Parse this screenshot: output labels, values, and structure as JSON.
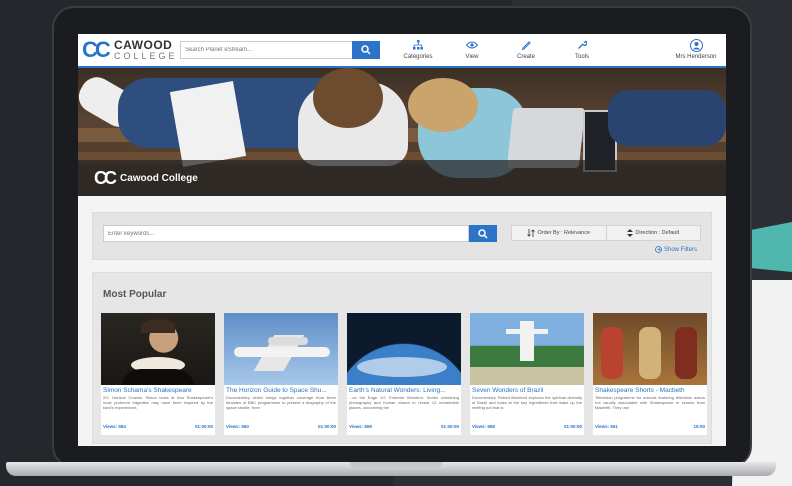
{
  "colors": {
    "brand_blue": "#2b74c7",
    "header_bg": "#ffffff",
    "page_bg": "#f4f4f4"
  },
  "header": {
    "logo_mark": "CC",
    "logo_name": "CAWOOD",
    "logo_sub": "COLLEGE",
    "search_placeholder": "Search Planet eStream...",
    "nav": [
      {
        "label": "Categories",
        "icon": "sitemap-icon"
      },
      {
        "label": "View",
        "icon": "eye-icon"
      },
      {
        "label": "Create",
        "icon": "pencil-icon"
      },
      {
        "label": "Tools",
        "icon": "wrench-icon"
      }
    ],
    "user_name": "Mrs Henderson",
    "user_icon": "user-avatar-icon"
  },
  "hero": {
    "mark": "CC",
    "title": "Cawood College"
  },
  "filter": {
    "placeholder": "Enter keywords...",
    "order_by": "Order By : Relevance",
    "direction": "Direction : Default",
    "show_filters": "Show Filters"
  },
  "popular": {
    "heading": "Most Popular",
    "items": [
      {
        "title": "Simon Schama's Shakespeare",
        "desc": "2/2. Horizon Crowns. Simon looks at how Shakespeare's most profound tragedies may have been inspired by the bard's experiences",
        "views": "Views: 584",
        "duration": "01:00:00"
      },
      {
        "title": "The Horizon Guide to Space Shu...",
        "desc": "Documentary which brings together coverage from three decades of BBC programmes to present a biography of the space shuttle, from",
        "views": "Views: 660",
        "duration": "01:00:00"
      },
      {
        "title": "Earth's Natural Wonders: Living...",
        "desc": "...on the Edge 1/2. Extreme Wonders: Series combining photography and human drama to reveal 12 remarkable places, uncovering the",
        "views": "Views: 659",
        "duration": "01:00:00"
      },
      {
        "title": "Seven Wonders of Brazil",
        "desc": "Documentary. Robert Beckford explores the spiritual diversity of Brazil and looks at the key ingredients that make up the melting pot that is",
        "views": "Views: 658",
        "duration": "01:00:00"
      },
      {
        "title": "Shakespeare Shorts - Macbeth",
        "desc": "Television programme for schools featuring television actors not usually associated with Shakespeare in scenes from Macbeth. They use",
        "views": "Views: 651",
        "duration": "15:00"
      }
    ]
  }
}
